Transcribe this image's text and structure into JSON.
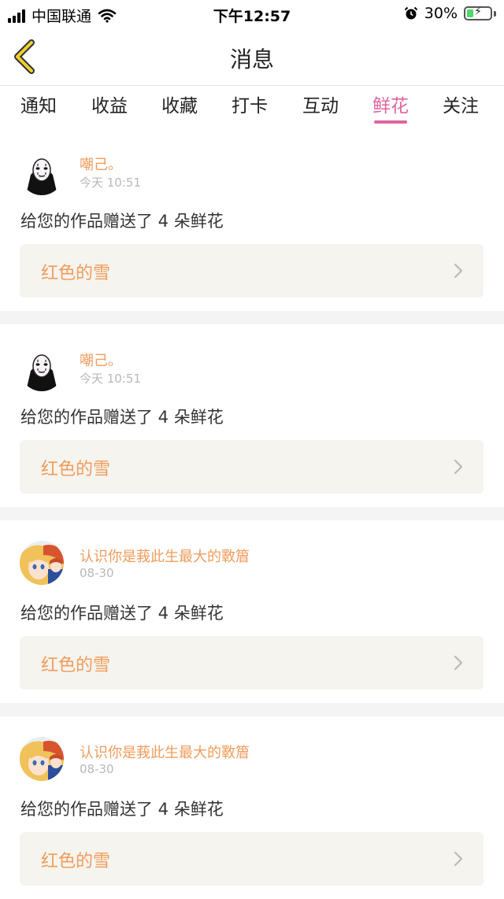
{
  "status_bar": {
    "carrier": "中国联通",
    "time": "下午12:57",
    "battery": "30%",
    "battery_level": 0.3
  },
  "nav": {
    "title": "消息"
  },
  "tabs": [
    {
      "label": "通知"
    },
    {
      "label": "收益"
    },
    {
      "label": "收藏"
    },
    {
      "label": "打卡"
    },
    {
      "label": "互动"
    },
    {
      "label": "鲜花",
      "active": true
    },
    {
      "label": "关注"
    }
  ],
  "messages": [
    {
      "user": "嘲己。",
      "time": "今天 10:51",
      "text": "给您的作品赠送了 4 朵鲜花",
      "work": "红色的雪",
      "avatar": "masked-figure-avatar"
    },
    {
      "user": "嘲己。",
      "time": "今天 10:51",
      "text": "给您的作品赠送了 4 朵鲜花",
      "work": "红色的雪",
      "avatar": "masked-figure-avatar"
    },
    {
      "user": "认识你是莪此生最大的斁篃",
      "time": "08-30",
      "text": "给您的作品赠送了 4 朵鲜花",
      "work": "红色的雪",
      "avatar": "anime-character-avatar"
    },
    {
      "user": "认识你是莪此生最大的斁篃",
      "time": "08-30",
      "text": "给您的作品赠送了 4 朵鲜花",
      "work": "红色的雪",
      "avatar": "anime-character-avatar"
    }
  ],
  "colors": {
    "accent_pink": "#e0649e",
    "username_orange": "#f19c5c",
    "link_bg": "#f5f4ee",
    "back_arrow_yellow": "#f0d030"
  }
}
